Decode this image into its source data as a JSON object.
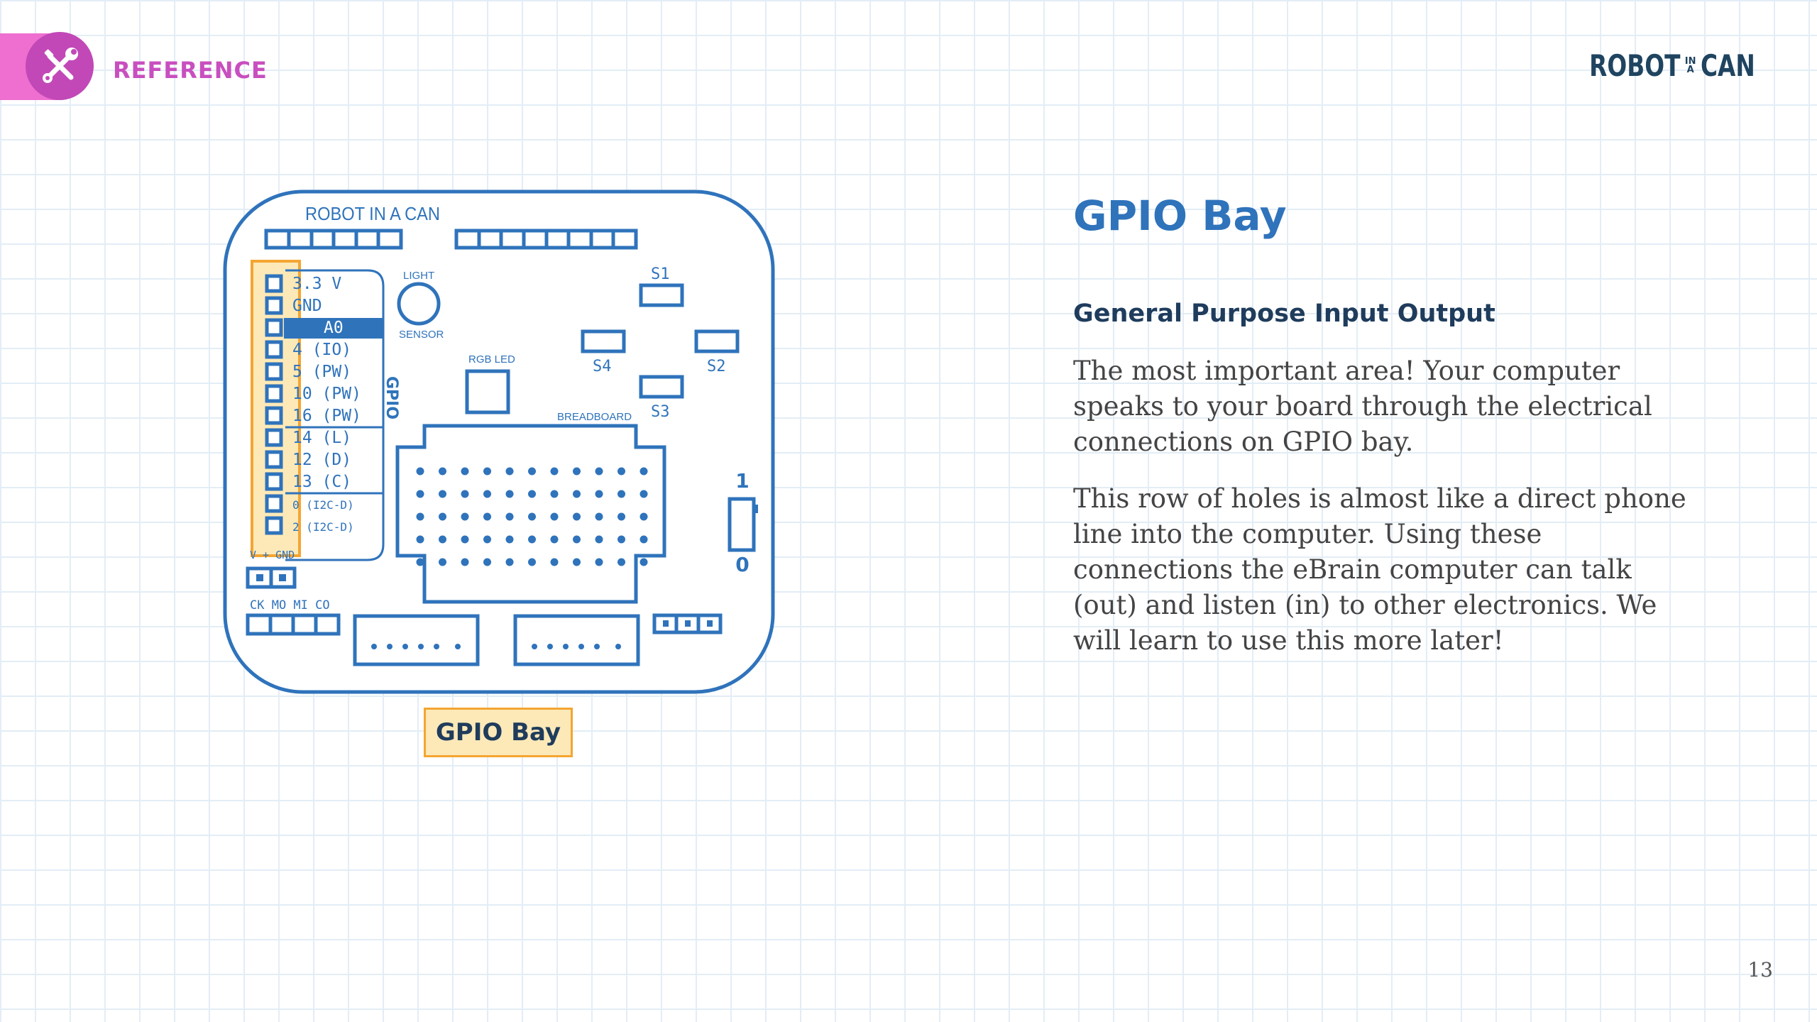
{
  "header": {
    "section_label": "REFERENCE",
    "section_icon": "tools-icon",
    "logo": {
      "word1": "ROBOT",
      "small_top": "IN",
      "small_bottom": "A",
      "word2": "CAN"
    }
  },
  "board": {
    "brand_label": "ROBOT IN A CAN",
    "light_label": "LIGHT",
    "sensor_label": "SENSOR",
    "rgb_label": "RGB LED",
    "breadboard_label": "BREADBOARD",
    "gpio_label": "GPIO",
    "switches": [
      "S1",
      "S2",
      "S3",
      "S4"
    ],
    "pins": [
      "3.3 V",
      "GND",
      "A0",
      "4 (IO)",
      "5 (PW)",
      "10 (PW)",
      "16 (PW)",
      "14 (L)",
      "12 (D)",
      "13 (C)",
      "0 (I2C-D)",
      "2 (I2C-D)"
    ],
    "power_label": "V + GND",
    "spi_label": "CK MO MI CO",
    "toggle_on": "1",
    "toggle_off": "0"
  },
  "callout": {
    "label": "GPIO Bay"
  },
  "content": {
    "title": "GPIO Bay",
    "subtitle": "General Purpose Input Output",
    "paragraph1": "The most important area! Your computer speaks to your board through the electrical connections on GPIO bay.",
    "paragraph2": "This row of holes is almost like a direct phone line into the computer. Using these connections the eBrain computer can talk (out) and listen (in) to other electronics. We will learn to use this more later!"
  },
  "footer": {
    "page_number": "13"
  },
  "colors": {
    "accent_pink": "#ee6fcf",
    "board_blue": "#2f73bb",
    "navy": "#1f3c5c",
    "highlight_orange": "#f4a531"
  }
}
